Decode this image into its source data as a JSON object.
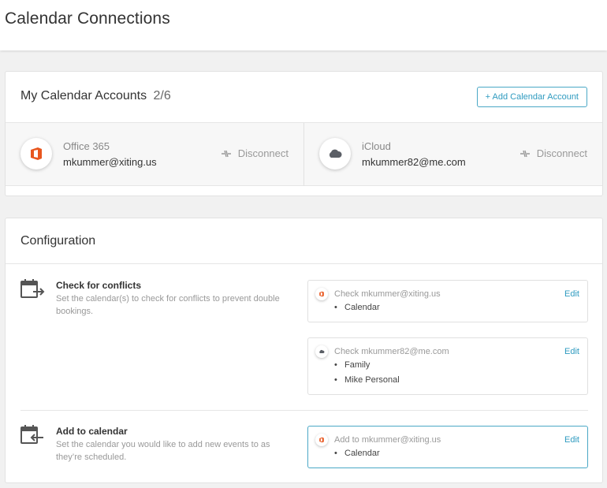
{
  "page": {
    "title": "Calendar Connections"
  },
  "accounts": {
    "title": "My Calendar Accounts",
    "count": "2/6",
    "add_button": "+ Add Calendar Account",
    "items": [
      {
        "provider": "Office 365",
        "email": "mkummer@xiting.us",
        "action": "Disconnect",
        "icon": "office365-icon"
      },
      {
        "provider": "iCloud",
        "email": "mkummer82@me.com",
        "action": "Disconnect",
        "icon": "icloud-icon"
      }
    ]
  },
  "configuration": {
    "title": "Configuration",
    "conflicts": {
      "title": "Check for conflicts",
      "description": "Set the calendar(s) to check for conflicts to prevent double bookings.",
      "boxes": [
        {
          "label": "Check mkummer@xiting.us",
          "edit": "Edit",
          "icon": "office365-icon",
          "calendars": [
            "Calendar"
          ]
        },
        {
          "label": "Check mkummer82@me.com",
          "edit": "Edit",
          "icon": "icloud-icon",
          "calendars": [
            "Family",
            "Mike Personal"
          ]
        }
      ]
    },
    "add": {
      "title": "Add to calendar",
      "description": "Set the calendar you would like to add new events to as they’re scheduled.",
      "box": {
        "label": "Add to mkummer@xiting.us",
        "edit": "Edit",
        "icon": "office365-icon",
        "calendars": [
          "Calendar"
        ]
      }
    }
  },
  "colors": {
    "accent": "#2f9bc0",
    "office": "#e8561e",
    "icloud": "#5b5f66"
  }
}
